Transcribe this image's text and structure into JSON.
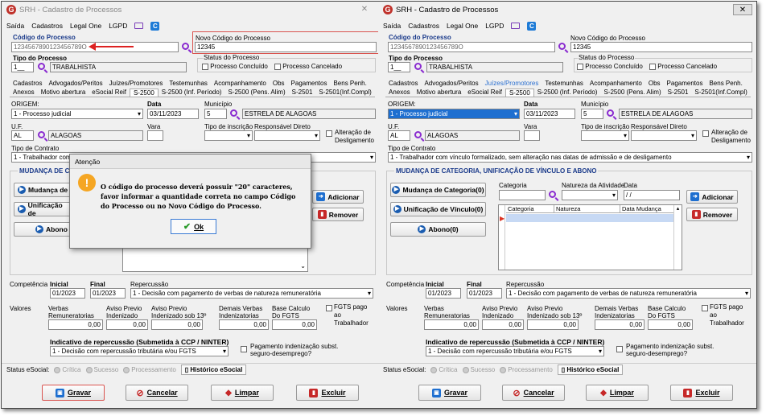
{
  "title": "SRH - Cadastro de Processos",
  "menu": {
    "saida": "Saída",
    "cadastros": "Cadastros",
    "legal_one": "Legal One",
    "lgpd": "LGPD"
  },
  "header": {
    "codigo_label": "Código do Processo",
    "codigo_value": "1234567890123456789O",
    "novo_label": "Novo Código do Processo",
    "novo_value": "12345",
    "tipo_label": "Tipo do Processo",
    "tipo_code": "1__",
    "tipo_name": "TRABALHISTA",
    "status_label": "Status do Processo",
    "concluido": "Processo Concluído",
    "cancelado": "Processo Cancelado"
  },
  "tabs_row1": [
    "Cadastros",
    "Advogados/Peritos",
    "Juízes/Promotores",
    "Testemunhas",
    "Acompanhamento",
    "Obs",
    "Pagamentos",
    "Bens Penh."
  ],
  "tabs_row2": [
    "Anexos",
    "Motivo abertura",
    "eSocial Reif",
    "S-2500",
    "S-2500 (Inf. Período)",
    "S-2500 (Pens. Alim)",
    "S-2501",
    "S-2501(Inf.Compl)"
  ],
  "form": {
    "origem_label": "ORIGEM:",
    "origem_value": "1 - Processo judicial",
    "data_label": "Data",
    "data_value": "03/11/2023",
    "municipio_label": "Município",
    "municipio_code": "5",
    "municipio_name": "ESTRELA DE ALAGOAS",
    "uf_label": "U.F.",
    "uf_value": "AL",
    "uf_name": "ALAGOAS",
    "vara_label": "Vara",
    "tipo_insc_label": "Tipo de inscrição",
    "resp_label": "Responsável Direto",
    "alteracao_label": "Alteração de Desligamento",
    "contrato_label": "Tipo de Contrato",
    "contrato_left": "1 - Trabalhador com",
    "contrato_value": "1 - Trabalhador com vínculo formalizado, sem alteração nas datas de admissão e de desligamento",
    "mudanca_title": "MUDANÇA DE CATEGORIA, UNIFICAÇÃO DE VÍNCULO E ABONO",
    "mudanca_short": "MUDANÇA DE CATE",
    "btn_mudanca": "Mudança de Categoria(0)",
    "btn_mudanca_short": "Mudança de",
    "btn_unificacao": "Unificação de Vínculo(0)",
    "btn_unificacao_short": "Unificação de",
    "btn_abono": "Abono(0)",
    "btn_abono_short": "Abono",
    "categoria_label": "Categoria",
    "natureza_label": "Natureza da Atividade",
    "data2_label": "Data",
    "data2_value": "/ /",
    "btn_adicionar": "Adicionar",
    "btn_remover": "Remover",
    "grid_cols": [
      "Categoria",
      "Natureza",
      "Data Mudança"
    ]
  },
  "comp": {
    "label": "Competência",
    "inicial_label": "Inicial",
    "inicial": "01/2023",
    "final_label": "Final",
    "final": "01/2023",
    "repercussao_label": "Repercussão",
    "repercussao": "1 - Decisão com pagamento de verbas de natureza remuneratória"
  },
  "valores": {
    "label": "Valores",
    "verbas": "Verbas Remuneratorias",
    "aviso": "Aviso Previo Indenizado",
    "aviso13": "Aviso Previo Indenizado sob 13º",
    "demais": "Demais Verbas Indenizatorias",
    "base": "Base Calculo Do FGTS",
    "fgts": "FGTS pago ao Trabalhador",
    "zero": "0,00"
  },
  "indicativo": {
    "label": "Indicativo de repercussão (Submetida à CCP / NINTER)",
    "value": "1 - Decisão com repercussão tributária e/ou FGTS",
    "pagamento": "Pagamento indenização subst. seguro-desemprego?"
  },
  "status": {
    "label": "Status eSocial:",
    "critica": "Crítica",
    "sucesso": "Sucesso",
    "processamento": "Processamento",
    "historico": "Histórico eSocial"
  },
  "footer": {
    "gravar": "Gravar",
    "cancelar": "Cancelar",
    "limpar": "Limpar",
    "excluir": "Excluir"
  },
  "dialog": {
    "title": "Atenção",
    "message": "O código do processo deverá possuir \"20\" caracteres, favor informar a quantidade correta no campo Código do Processo ou no Novo Código do Processo.",
    "ok": "Ok"
  }
}
